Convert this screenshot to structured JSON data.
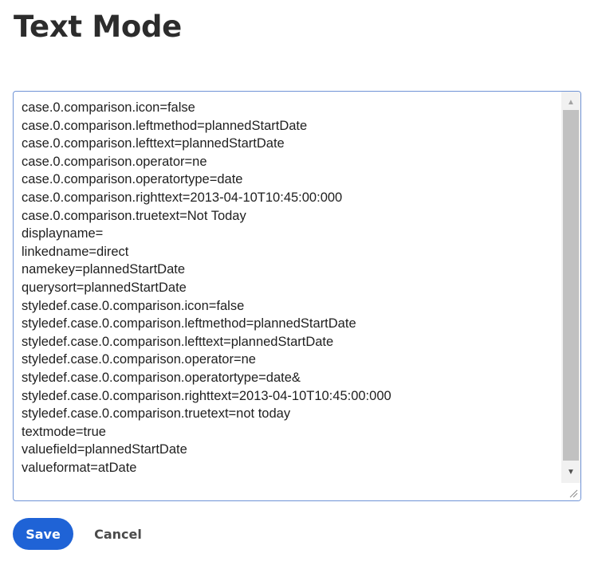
{
  "page": {
    "title": "Text Mode"
  },
  "editor": {
    "lines": [
      "case.0.comparison.icon=false",
      "case.0.comparison.leftmethod=plannedStartDate",
      "case.0.comparison.lefttext=plannedStartDate",
      "case.0.comparison.operator=ne",
      "case.0.comparison.operatortype=date",
      "case.0.comparison.righttext=2013-04-10T10:45:00:000",
      "case.0.comparison.truetext=Not Today",
      "displayname=",
      "linkedname=direct",
      "namekey=plannedStartDate",
      "querysort=plannedStartDate",
      "styledef.case.0.comparison.icon=false",
      "styledef.case.0.comparison.leftmethod=plannedStartDate",
      "styledef.case.0.comparison.lefttext=plannedStartDate",
      "styledef.case.0.comparison.operator=ne",
      "styledef.case.0.comparison.operatortype=date&",
      "styledef.case.0.comparison.righttext=2013-04-10T10:45:00:000",
      "styledef.case.0.comparison.truetext=not today",
      "textmode=true",
      "valuefield=plannedStartDate",
      "valueformat=atDate"
    ]
  },
  "actions": {
    "save_label": "Save",
    "cancel_label": "Cancel"
  },
  "colors": {
    "primary": "#1f63d6",
    "editor_border": "#6f93d6",
    "text": "#2c2c2c"
  }
}
